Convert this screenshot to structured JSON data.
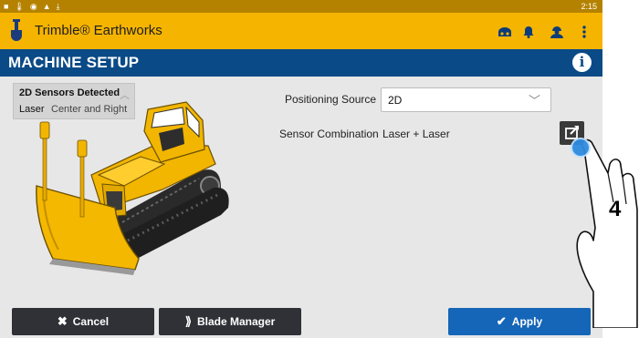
{
  "status_bar": {
    "time": "2:15",
    "icons": [
      "square-icon",
      "temperature-icon",
      "android-icon",
      "warning-icon",
      "download-icon"
    ]
  },
  "app_bar": {
    "title": "Trimble® Earthworks",
    "icons": [
      "machine-icon",
      "bell-icon",
      "user-icon",
      "more-vert-icon"
    ]
  },
  "page": {
    "title": "MACHINE SETUP"
  },
  "sensors_card": {
    "title": "2D Sensors Detected",
    "sensor_type": "Laser",
    "sensor_position": "Center and Right"
  },
  "form": {
    "positioning_source": {
      "label": "Positioning Source",
      "value": "2D"
    },
    "sensor_combination": {
      "label": "Sensor Combination",
      "value": "Laser + Laser"
    }
  },
  "buttons": {
    "cancel": "Cancel",
    "blade_manager": "Blade Manager",
    "apply": "Apply"
  },
  "annotation": {
    "step": "4"
  },
  "colors": {
    "accent_yellow": "#f5b400",
    "header_blue": "#0a4a86",
    "apply_blue": "#1565b8",
    "dark_button": "#2f3137"
  }
}
